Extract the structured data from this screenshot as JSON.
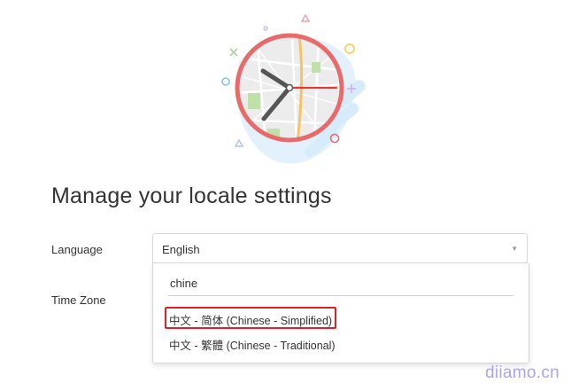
{
  "page": {
    "title": "Manage your locale settings"
  },
  "language": {
    "label": "Language",
    "selected_value": "English",
    "search_value": "chine",
    "options": [
      "中文 - 简体 (Chinese - Simplified)",
      "中文 - 繁體 (Chinese - Traditional)"
    ],
    "highlighted_option_index": 0
  },
  "timezone": {
    "label": "Time Zone"
  },
  "watermark": {
    "text": "diiamo.cn"
  },
  "icons": {
    "clock": "clock-illustration-icon",
    "caret": "chevron-down-icon"
  },
  "colors": {
    "clock_ring": "#e86a6a",
    "highlight_border": "#e02020",
    "watermark": "#a9a3f2",
    "illustration_blob": "#d6ecfb"
  }
}
